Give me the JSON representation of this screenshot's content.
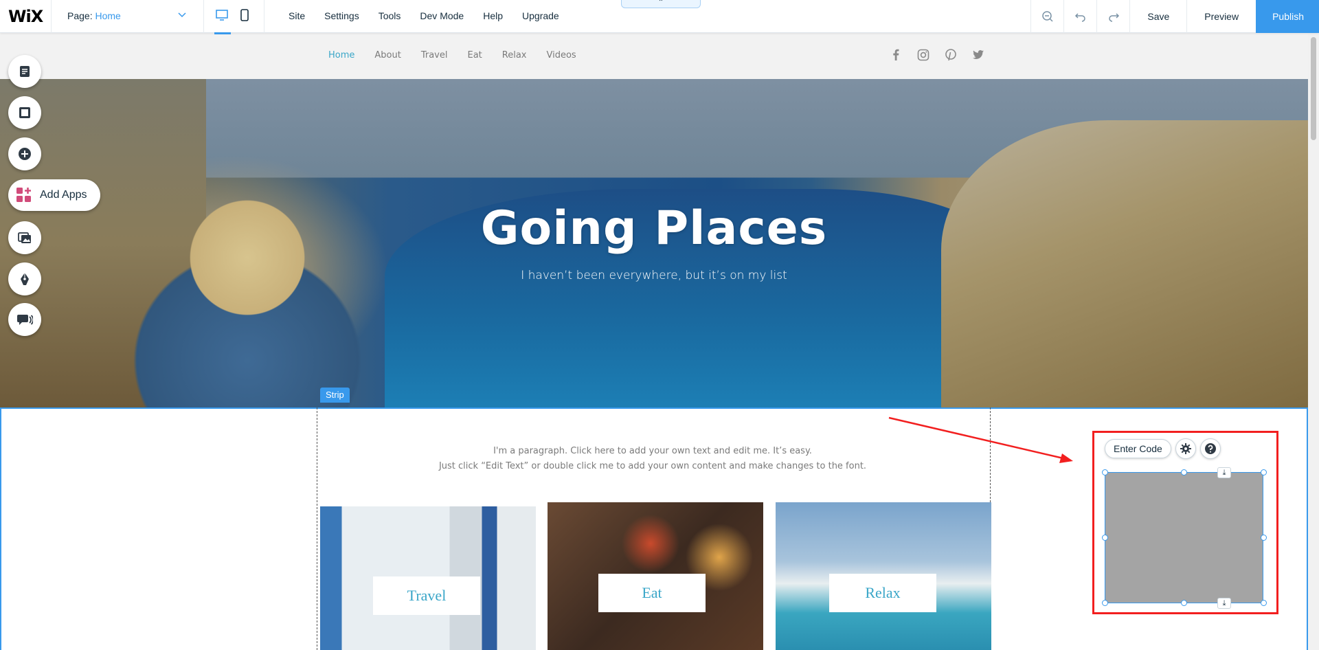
{
  "topbar": {
    "logo": "WiX",
    "page_label": "Page:",
    "page_value": "Home",
    "menu": [
      "Site",
      "Settings",
      "Tools",
      "Dev Mode",
      "Help",
      "Upgrade"
    ],
    "save": "Save",
    "preview": "Preview",
    "publish": "Publish",
    "accent": "#3899ec"
  },
  "left_tools": {
    "add_apps": "Add Apps"
  },
  "site": {
    "nav": [
      "Home",
      "About",
      "Travel",
      "Eat",
      "Relax",
      "Videos"
    ],
    "active_nav": "Home",
    "social": [
      "facebook-icon",
      "instagram-icon",
      "pinterest-icon",
      "twitter-icon"
    ],
    "hero_title": "Going Places",
    "hero_subtitle": "I haven’t been everywhere, but it’s on my list",
    "strip_label": "Strip",
    "paragraph_line1": "I'm a paragraph. Click here to add your own text and edit me. It’s easy.",
    "paragraph_line2": "Just click “Edit Text” or double click me to add your own content and make changes to the font.",
    "cards": [
      "Travel",
      "Eat",
      "Relax"
    ]
  },
  "embed": {
    "enter_code": "Enter Code",
    "highlight": "#f21f1f"
  }
}
